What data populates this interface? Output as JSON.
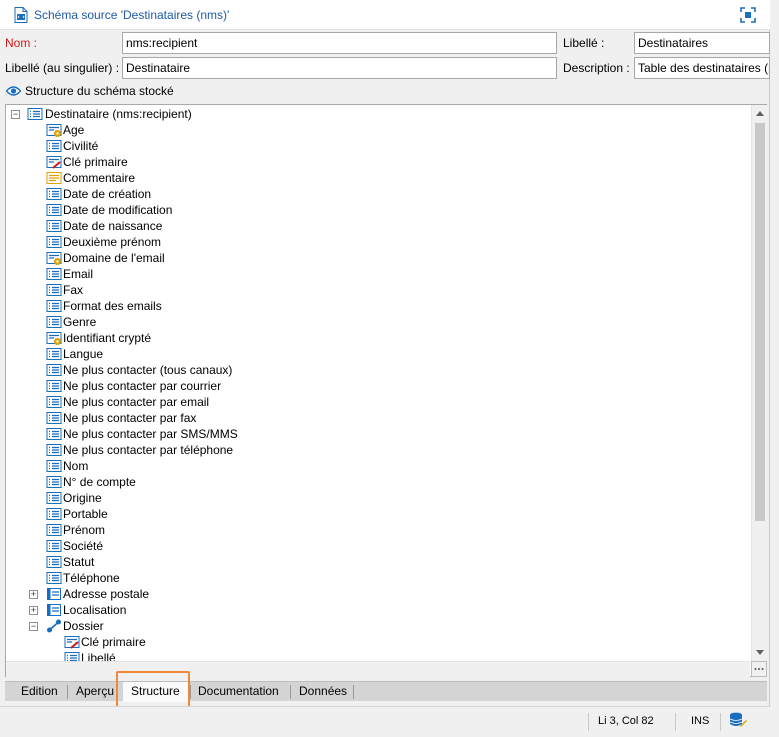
{
  "window": {
    "title": "Schéma source 'Destinataires (nms)'"
  },
  "form": {
    "name_label": "Nom :",
    "name_value": "nms:recipient",
    "libelle_label": "Libellé :",
    "libelle_value": "Destinataires",
    "singular_label": "Libellé (au singulier) :",
    "singular_value": "Destinataire",
    "description_label": "Description :",
    "description_value": "Table des destinataires (p"
  },
  "structure_header": "Structure du schéma stocké",
  "tree": {
    "root": {
      "label": "Destinataire (nms:recipient)",
      "icon": "table-icon",
      "state": "expanded"
    },
    "items": [
      {
        "label": "Age",
        "icon": "computed-field-icon"
      },
      {
        "label": "Civilité",
        "icon": "field-icon"
      },
      {
        "label": "Clé primaire",
        "icon": "primary-key-icon"
      },
      {
        "label": "Commentaire",
        "icon": "memo-field-icon"
      },
      {
        "label": "Date de création",
        "icon": "field-icon"
      },
      {
        "label": "Date de modification",
        "icon": "field-icon"
      },
      {
        "label": "Date de naissance",
        "icon": "field-icon"
      },
      {
        "label": "Deuxième prénom",
        "icon": "field-icon"
      },
      {
        "label": "Domaine de l'email",
        "icon": "computed-field-icon"
      },
      {
        "label": "Email",
        "icon": "field-icon"
      },
      {
        "label": "Fax",
        "icon": "field-icon"
      },
      {
        "label": "Format des emails",
        "icon": "field-icon"
      },
      {
        "label": "Genre",
        "icon": "field-icon"
      },
      {
        "label": "Identifiant crypté",
        "icon": "computed-field-icon"
      },
      {
        "label": "Langue",
        "icon": "field-icon"
      },
      {
        "label": "Ne plus contacter (tous canaux)",
        "icon": "field-icon"
      },
      {
        "label": "Ne plus contacter par courrier",
        "icon": "field-icon"
      },
      {
        "label": "Ne plus contacter par email",
        "icon": "field-icon"
      },
      {
        "label": "Ne plus contacter par fax",
        "icon": "field-icon"
      },
      {
        "label": "Ne plus contacter par SMS/MMS",
        "icon": "field-icon"
      },
      {
        "label": "Ne plus contacter par téléphone",
        "icon": "field-icon"
      },
      {
        "label": "Nom",
        "icon": "field-icon"
      },
      {
        "label": "N° de compte",
        "icon": "field-icon"
      },
      {
        "label": "Origine",
        "icon": "field-icon"
      },
      {
        "label": "Portable",
        "icon": "field-icon"
      },
      {
        "label": "Prénom",
        "icon": "field-icon"
      },
      {
        "label": "Société",
        "icon": "field-icon"
      },
      {
        "label": "Statut",
        "icon": "field-icon"
      },
      {
        "label": "Téléphone",
        "icon": "field-icon"
      },
      {
        "label": "Adresse postale",
        "icon": "element-icon",
        "state": "collapsed"
      },
      {
        "label": "Localisation",
        "icon": "element-icon",
        "state": "collapsed"
      },
      {
        "label": "Dossier",
        "icon": "link-icon",
        "state": "expanded"
      }
    ],
    "dossier_children": [
      {
        "label": "Clé primaire",
        "icon": "primary-key-icon"
      },
      {
        "label": "Libellé",
        "icon": "field-icon"
      }
    ]
  },
  "tabs": [
    {
      "label": "Edition",
      "active": false
    },
    {
      "label": "Aperçu",
      "active": false
    },
    {
      "label": "Structure",
      "active": true
    },
    {
      "label": "Documentation",
      "active": false
    },
    {
      "label": "Données",
      "active": false
    }
  ],
  "status": {
    "position": "Li 3, Col 82",
    "mode": "INS"
  },
  "colors": {
    "title_blue": "#1e5aa8",
    "required_label_red": "#d01818",
    "highlight_orange": "#f0883a",
    "icon_blue": "#1a6ec2"
  }
}
